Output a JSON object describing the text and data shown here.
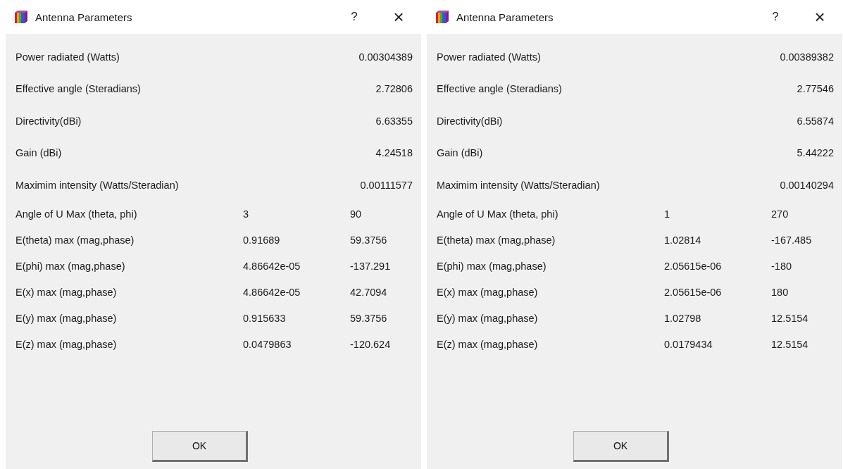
{
  "dialogs": [
    {
      "title": "Antenna Parameters",
      "help": "?",
      "close": "×",
      "rows": [
        {
          "label": "Power radiated (Watts)",
          "values": [
            "0.00304389"
          ]
        },
        {
          "label": "Effective angle (Steradians)",
          "values": [
            "2.72806"
          ]
        },
        {
          "label": "Directivity(dBi)",
          "values": [
            "6.63355"
          ]
        },
        {
          "label": "Gain (dBi)",
          "values": [
            "4.24518"
          ]
        },
        {
          "label": "Maximim intensity (Watts/Steradian)",
          "values": [
            "0.00111577"
          ]
        },
        {
          "label": "Angle of U Max (theta, phi)",
          "values": [
            "3",
            "90"
          ]
        },
        {
          "label": "E(theta) max (mag,phase)",
          "values": [
            "0.91689",
            "59.3756"
          ]
        },
        {
          "label": "E(phi) max (mag,phase)",
          "values": [
            "4.86642e-05",
            "-137.291"
          ]
        },
        {
          "label": "E(x) max (mag,phase)",
          "values": [
            "4.86642e-05",
            "42.7094"
          ]
        },
        {
          "label": "E(y) max (mag,phase)",
          "values": [
            "0.915633",
            "59.3756"
          ]
        },
        {
          "label": "E(z) max (mag,phase)",
          "values": [
            "0.0479863",
            "-120.624"
          ]
        }
      ],
      "button": "OK"
    },
    {
      "title": "Antenna Parameters",
      "help": "?",
      "close": "×",
      "rows": [
        {
          "label": "Power radiated (Watts)",
          "values": [
            "0.00389382"
          ]
        },
        {
          "label": "Effective angle (Steradians)",
          "values": [
            "2.77546"
          ]
        },
        {
          "label": "Directivity(dBi)",
          "values": [
            "6.55874"
          ]
        },
        {
          "label": "Gain (dBi)",
          "values": [
            "5.44222"
          ]
        },
        {
          "label": "Maximim intensity (Watts/Steradian)",
          "values": [
            "0.00140294"
          ]
        },
        {
          "label": "Angle of U Max (theta, phi)",
          "values": [
            "1",
            "270"
          ]
        },
        {
          "label": "E(theta) max (mag,phase)",
          "values": [
            "1.02814",
            "-167.485"
          ]
        },
        {
          "label": "E(phi) max (mag,phase)",
          "values": [
            "2.05615e-06",
            "-180"
          ]
        },
        {
          "label": "E(x) max (mag,phase)",
          "values": [
            "2.05615e-06",
            "180"
          ]
        },
        {
          "label": "E(y) max (mag,phase)",
          "values": [
            "1.02798",
            "12.5154"
          ]
        },
        {
          "label": "E(z) max (mag,phase)",
          "values": [
            "0.0179434",
            "12.5154"
          ]
        }
      ],
      "button": "OK"
    }
  ]
}
